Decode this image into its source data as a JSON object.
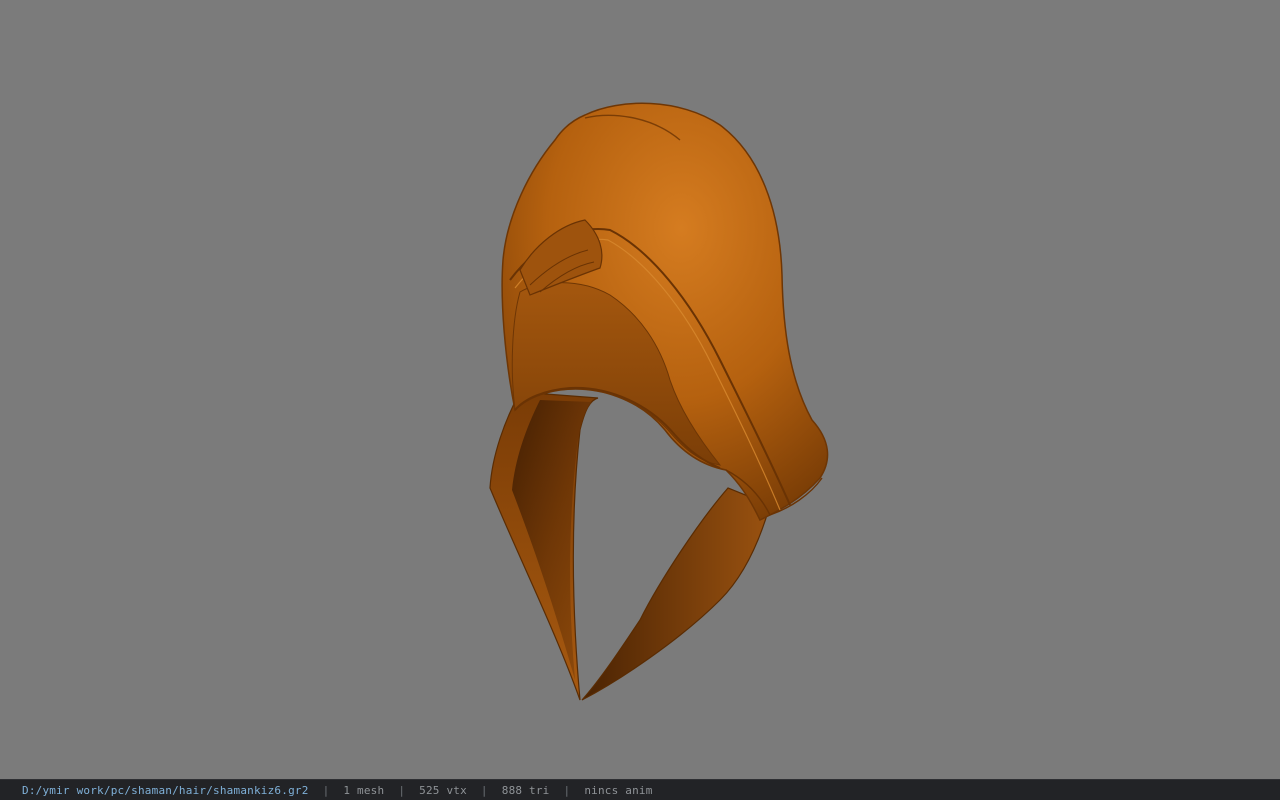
{
  "viewport": {
    "background_color": "#7b7b7b",
    "model_name": "hood-mesh",
    "model_color": "#c06a14"
  },
  "statusbar": {
    "path": "D:/ymir work/pc/shaman/hair/shamankiz6.gr2",
    "separator": "|",
    "mesh_count": "1 mesh",
    "vertex_count": "525 vtx",
    "triangle_count": "888 tri",
    "anim_status": "nincs anim"
  }
}
